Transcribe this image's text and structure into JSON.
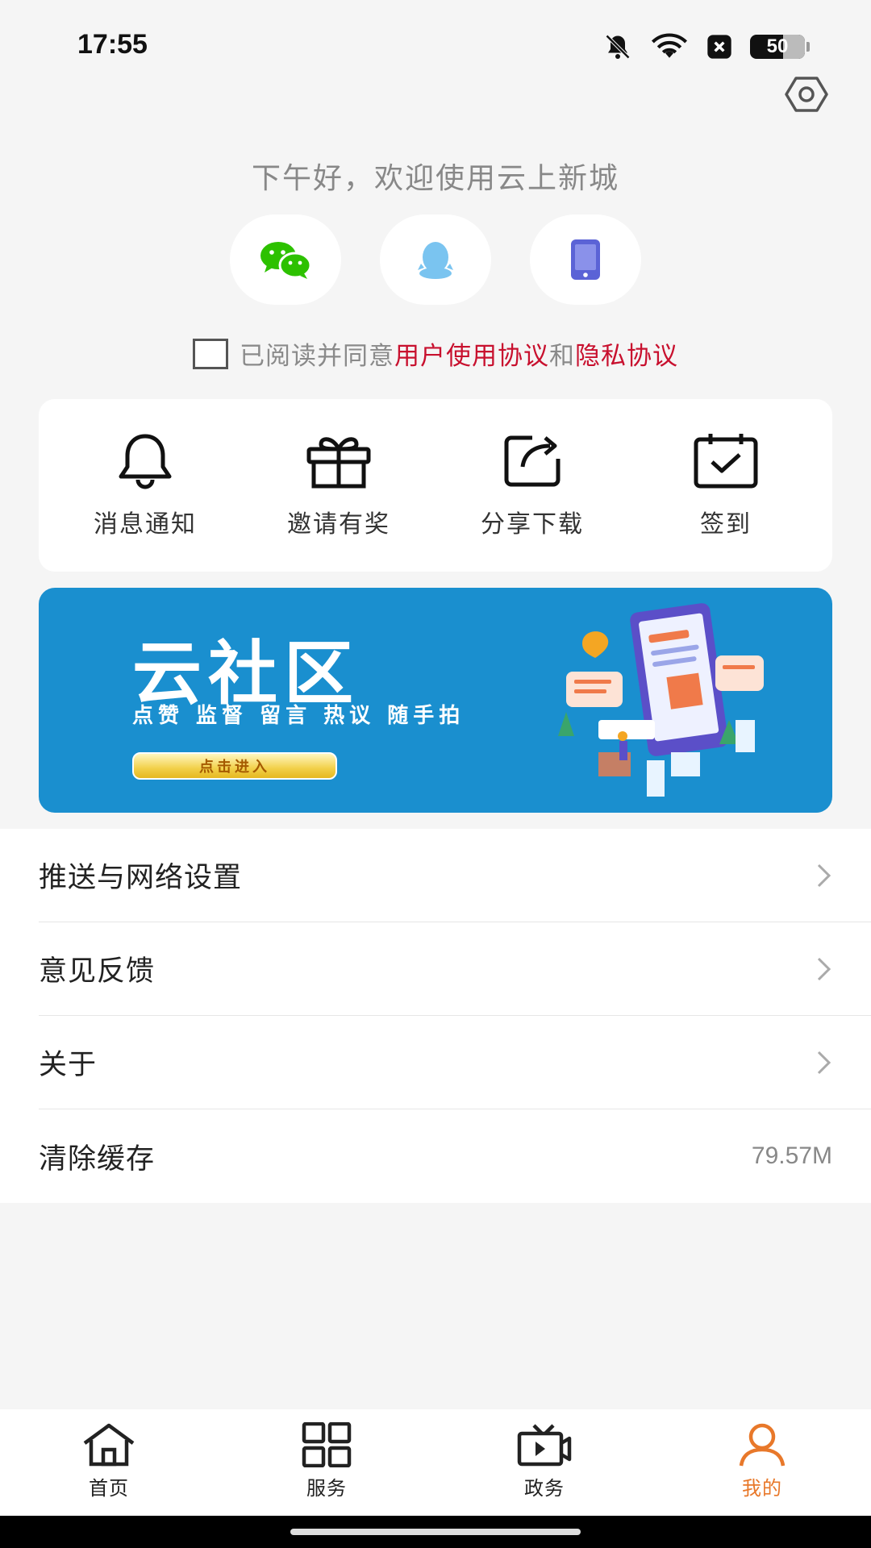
{
  "status_bar": {
    "time": "17:55",
    "battery": "50",
    "icons": [
      "bell-muted-icon",
      "wifi-icon",
      "notification-x-icon",
      "battery-icon"
    ]
  },
  "header": {
    "settings_icon": "settings-hexagon-icon"
  },
  "login": {
    "greeting": "下午好，欢迎使用云上新城",
    "methods": [
      {
        "name": "wechat",
        "icon": "wechat-icon",
        "color": "#2dc100"
      },
      {
        "name": "qq",
        "icon": "qq-penguin-icon",
        "color": "#7ac4f0"
      },
      {
        "name": "phone",
        "icon": "phone-icon",
        "color": "#5b63d6"
      }
    ],
    "agree_prefix": "已阅读并同意",
    "agree_link1": "用户使用协议",
    "agree_and": "和",
    "agree_link2": "隐私协议"
  },
  "quick_actions": [
    {
      "label": "消息通知",
      "icon": "bell-icon"
    },
    {
      "label": "邀请有奖",
      "icon": "gift-icon"
    },
    {
      "label": "分享下载",
      "icon": "share-icon"
    },
    {
      "label": "签到",
      "icon": "calendar-check-icon"
    }
  ],
  "banner": {
    "title": "云社区",
    "subtitle": "点赞 监督 留言 热议 随手拍",
    "button": "点击进入",
    "color": "#1a8fcf"
  },
  "menu": [
    {
      "label": "推送与网络设置",
      "value": "",
      "chevron": true
    },
    {
      "label": "意见反馈",
      "value": "",
      "chevron": true
    },
    {
      "label": "关于",
      "value": "",
      "chevron": true
    },
    {
      "label": "清除缓存",
      "value": "79.57M",
      "chevron": false
    }
  ],
  "tabs": [
    {
      "label": "首页",
      "icon": "home-icon",
      "active": false
    },
    {
      "label": "服务",
      "icon": "grid-icon",
      "active": false
    },
    {
      "label": "政务",
      "icon": "tv-play-icon",
      "active": false
    },
    {
      "label": "我的",
      "icon": "user-icon",
      "active": true
    }
  ],
  "accent_color": "#e8782a"
}
